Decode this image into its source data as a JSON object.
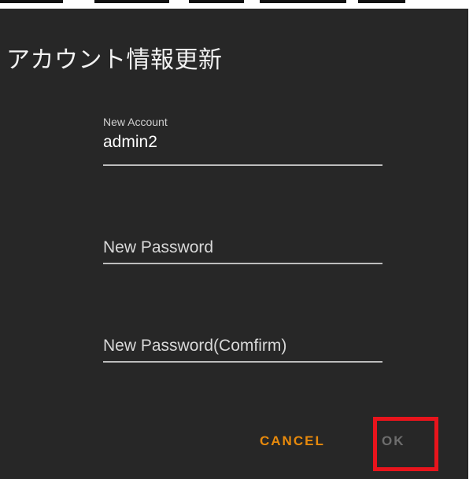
{
  "dialog": {
    "title": "アカウント情報更新",
    "fields": [
      {
        "label": "New Account",
        "value": "admin2"
      },
      {
        "placeholder": "New Password"
      },
      {
        "placeholder": "New Password(Comfirm)"
      }
    ],
    "buttons": {
      "cancel_label": "CANCEL",
      "ok_label": "OK"
    }
  },
  "colors": {
    "background": "#272727",
    "accent": "#e88a0c",
    "disabled_text": "#6e6e6e",
    "highlight": "#e8141c"
  }
}
